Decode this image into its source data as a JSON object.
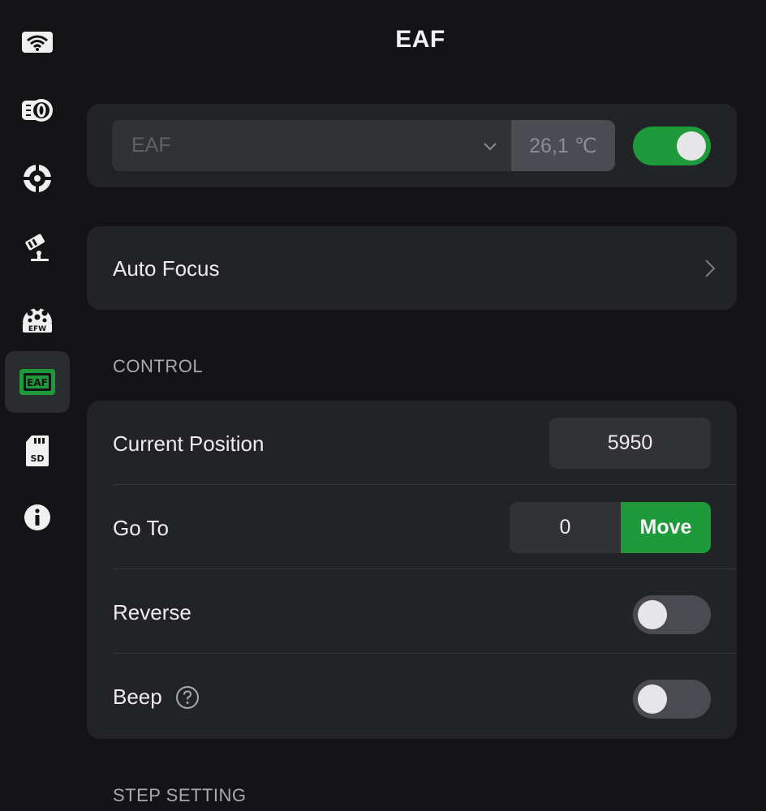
{
  "header": {
    "title": "EAF"
  },
  "sidebar": {
    "items": [
      {
        "name": "wifi",
        "icon": "wifi-icon",
        "active": false
      },
      {
        "name": "camera",
        "icon": "camera-icon",
        "active": false
      },
      {
        "name": "target",
        "icon": "crosshair-icon",
        "active": false
      },
      {
        "name": "mount",
        "icon": "telescope-mount-icon",
        "active": false
      },
      {
        "name": "efw",
        "icon": "filter-wheel-icon",
        "label": "EFW",
        "active": false
      },
      {
        "name": "eaf",
        "icon": "eaf-icon",
        "label": "EAF",
        "active": true
      },
      {
        "name": "sd",
        "icon": "sd-card-icon",
        "label": "SD",
        "active": false
      },
      {
        "name": "info",
        "icon": "info-icon",
        "active": false
      }
    ]
  },
  "device": {
    "selected": "EAF",
    "temperature": "26,1 ℃",
    "enabled": true
  },
  "auto_focus": {
    "label": "Auto Focus"
  },
  "sections": {
    "control": "CONTROL",
    "step_setting": "STEP SETTING"
  },
  "control": {
    "current_position_label": "Current Position",
    "current_position_value": "5950",
    "goto_label": "Go To",
    "goto_value": "0",
    "move_label": "Move",
    "reverse_label": "Reverse",
    "reverse_enabled": false,
    "beep_label": "Beep",
    "beep_enabled": false
  },
  "colors": {
    "accent_green": "#1e9a3a",
    "background": "#141416",
    "card": "#222326"
  }
}
